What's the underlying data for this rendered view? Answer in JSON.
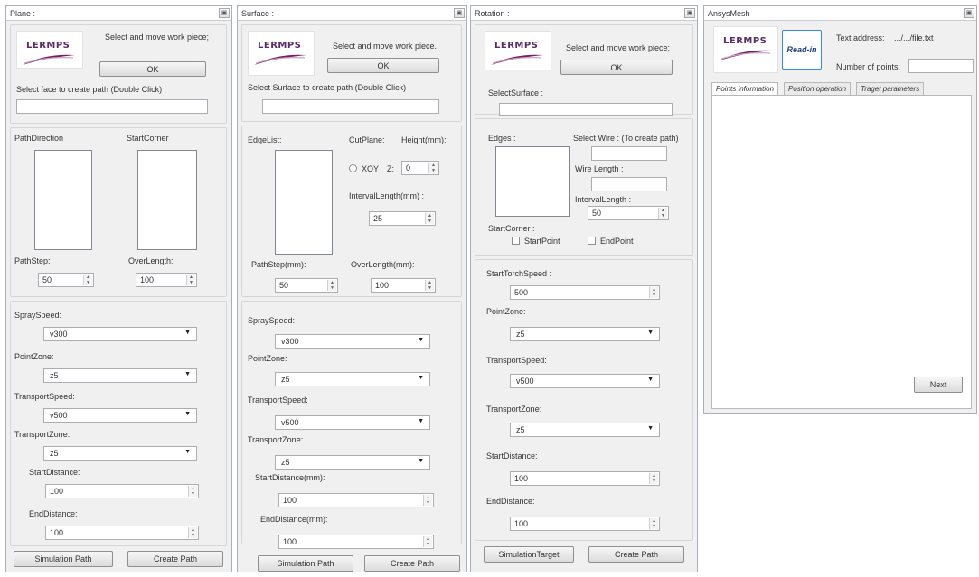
{
  "brand": {
    "logo_text": "LERMPS",
    "accent": "#7a1f5c",
    "accent2": "#c8a6c8"
  },
  "plane": {
    "title": "Plane :",
    "select_text": "Select and move work piece;",
    "ok": "OK",
    "face_label": "Select face to create path (Double Click)",
    "face_value": "",
    "path_direction": "PathDirection",
    "start_corner": "StartCorner",
    "path_step_label": "PathStep:",
    "path_step": "50",
    "over_length_label": "OverLength:",
    "over_length": "100",
    "spray_speed_label": "SpraySpeed:",
    "spray_speed": "v300",
    "point_zone_label": "PointZone:",
    "point_zone": "z5",
    "transport_speed_label": "TransportSpeed:",
    "transport_speed": "v500",
    "transport_zone_label": "TransportZone:",
    "transport_zone": "z5",
    "start_distance_label": "StartDistance:",
    "start_distance": "100",
    "end_distance_label": "EndDistance:",
    "end_distance": "100",
    "simulation_btn": "Simulation Path",
    "create_btn": "Create Path"
  },
  "surface": {
    "title": "Surface :",
    "select_text": "Select and move work piece.",
    "ok": "OK",
    "surface_label": "Select Surface to create path (Double Click)",
    "surface_value": "",
    "edge_list": "EdgeList:",
    "cut_plane": "CutPlane:",
    "height": "Height(mm):",
    "xoy": "XOY",
    "z": "Z:",
    "height_value": "0",
    "interval_label": "IntervalLength(mm) :",
    "interval_value": "25",
    "path_step_label": "PathStep(mm):",
    "path_step": "50",
    "over_length_label": "OverLength(mm):",
    "over_length": "100",
    "spray_speed_label": "SpraySpeed:",
    "spray_speed": "v300",
    "point_zone_label": "PointZone:",
    "point_zone": "z5",
    "transport_speed_label": "TransportSpeed:",
    "transport_speed": "v500",
    "transport_zone_label": "TransportZone:",
    "transport_zone": "z5",
    "start_distance_label": "StartDistance(mm):",
    "start_distance": "100",
    "end_distance_label": "EndDistance(mm):",
    "end_distance": "100",
    "simulation_btn": "Simulation Path",
    "create_btn": "Create Path"
  },
  "rotation": {
    "title": "Rotation :",
    "select_text": "Select and move work piece;",
    "ok": "OK",
    "select_surface_label": "SelectSurface :",
    "select_surface_value": "",
    "edges": "Edges :",
    "select_wire": "Select Wire : (To create path)",
    "wire_value": "",
    "wire_length_label": "Wire Length :",
    "wire_length_value": "",
    "interval_label": "IntervalLength :",
    "interval_value": "50",
    "start_corner": "StartCorner :",
    "start_point": "StartPoint",
    "end_point": "EndPoint",
    "start_torch_label": "StartTorchSpeed :",
    "start_torch": "500",
    "point_zone_label": "PointZone:",
    "point_zone": "z5",
    "transport_speed_label": "TransportSpeed:",
    "transport_speed": "v500",
    "transport_zone_label": "TransportZone:",
    "transport_zone": "z5",
    "start_distance_label": "StartDistance:",
    "start_distance": "100",
    "end_distance_label": "EndDistance:",
    "end_distance": "100",
    "simulation_btn": "SimulationTarget",
    "create_btn": "Create Path"
  },
  "ansys": {
    "title": "AnsysMesh",
    "read_in": "Read-in",
    "text_address_label": "Text address:",
    "text_address": ".../.../file.txt",
    "num_points_label": "Number of points:",
    "num_points": "",
    "tabs": [
      "Points information",
      "Position operation",
      "Traget parameters"
    ],
    "next": "Next"
  },
  "close_glyph": "▣"
}
